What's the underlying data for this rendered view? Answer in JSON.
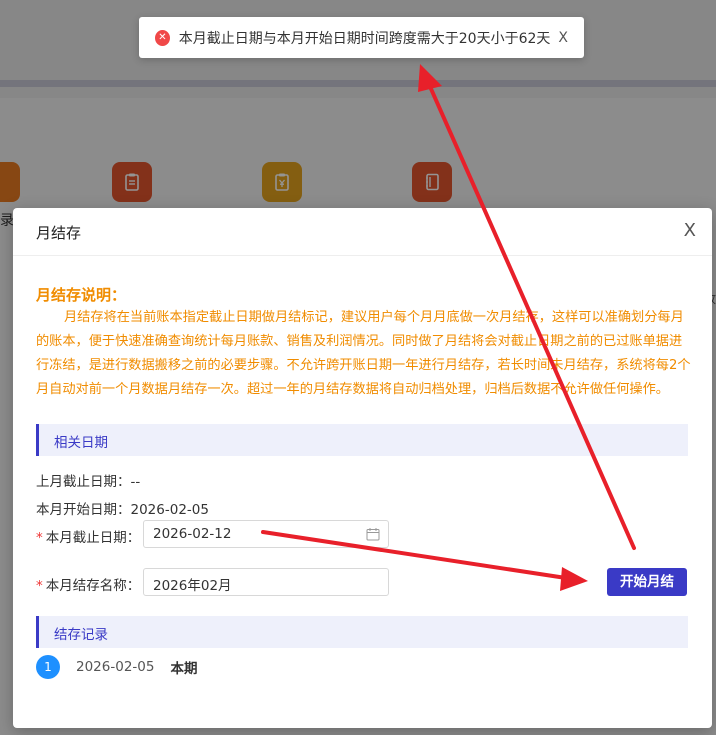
{
  "background": {
    "cut_text": "录表",
    "right_text": "收"
  },
  "toast": {
    "icon": "error-x-icon",
    "message": "本月截止日期与本月开始日期时间跨度需大于20天小于62天",
    "close": "X"
  },
  "modal": {
    "title": "月结存",
    "close": "X",
    "description": {
      "title": "月结存说明：",
      "body": "月结存将在当前账本指定截止日期做月结标记，建议用户每个月月底做一次月结存，这样可以准确划分每月的账本，便于快速准确查询统计每月账款、销售及利润情况。同时做了月结将会对截止日期之前的已过账单据进行冻结，是进行数据搬移之前的必要步骤。不允许跨开账日期一年进行月结存，若长时间未月结存，系统将每2个月自动对前一个月数据月结存一次。超过一年的月结存数据将自动归档处理，归档后数据不允许做任何操作。"
    },
    "dates_section": "相关日期",
    "last_cutoff_label": "上月截止日期：",
    "last_cutoff_value": "--",
    "start_date_label": "本月开始日期：",
    "start_date_value": "2026-02-05",
    "cutoff_field": {
      "required_mark": "*",
      "label": "本月截止日期：",
      "value": "2026-02-12"
    },
    "name_field": {
      "required_mark": "*",
      "label": "本月结存名称：",
      "value": "2026年02月"
    },
    "start_button": "开始月结",
    "records_section": "结存记录",
    "records": [
      {
        "index": "1",
        "date": "2026-02-05",
        "tag": "本期"
      }
    ]
  },
  "colors": {
    "accent": "#3a3ac6",
    "warning_text": "#f08c00",
    "error": "#f04848",
    "annotation_arrow": "#e8202a",
    "record_dot": "#1e90ff"
  }
}
